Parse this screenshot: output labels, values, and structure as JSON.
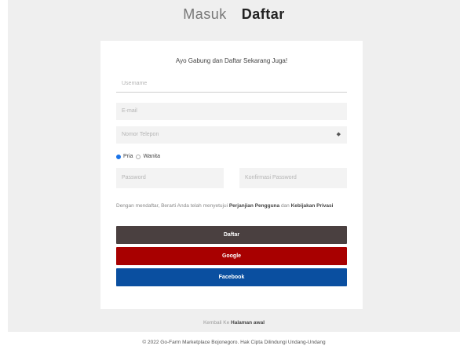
{
  "tabs": {
    "login": "Masuk",
    "register": "Daftar"
  },
  "form": {
    "title": "Ayo Gabung dan Daftar Sekarang Juga!",
    "username_placeholder": "Username",
    "email_placeholder": "E-mail",
    "phone_placeholder": "Nomor Telepon",
    "gender_male": "Pria",
    "gender_female": "Wanita",
    "password_placeholder": "Password",
    "confirm_password_placeholder": "Konfirmasi Password",
    "terms_prefix": "Dengan mendaftar, Berarti Anda telah menyetujui",
    "terms_link": "Perjanjian Pengguna",
    "terms_middle": "dan",
    "privacy_link": "Kebijakan Privasi",
    "submit_label": "Daftar",
    "google_label": "Google",
    "facebook_label": "Facebook"
  },
  "back": {
    "prefix": "Kembali Ke",
    "link": "Halaman awal"
  },
  "footer": {
    "text": "© 2022 Go-Farm Marketplace Bojonegoro. Hak Cipta Dilindungi Undang-Undang"
  },
  "colors": {
    "submit": "#4a4040",
    "google": "#a80000",
    "facebook": "#0a4fa0",
    "radio_active": "#1a73e8"
  }
}
